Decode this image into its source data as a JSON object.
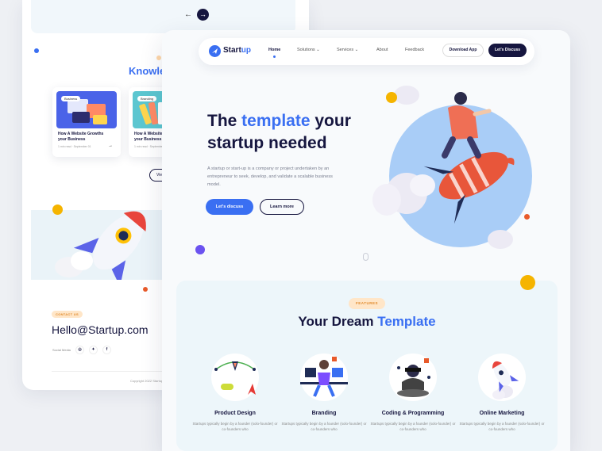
{
  "back_card": {
    "pager": {
      "prev_icon": "←",
      "next_icon": "→"
    },
    "section_title": "Knowle",
    "articles": [
      {
        "tag": "Business",
        "title": "How A Website Growths your Business",
        "meta": "1 min read · September 01",
        "arrow": "→"
      },
      {
        "tag": "Branding",
        "title": "How A Website Growths your Business",
        "meta": "1 min read · September 01",
        "arrow": ""
      }
    ],
    "view_label": "View",
    "contact_badge": "CONTACT US",
    "email": "Hello@Startup.com",
    "email_arrow": "→",
    "social_label": "Social Media",
    "social_icons": [
      "◎",
      "✦",
      "f"
    ],
    "copyright": "Copyright 2022 Startup"
  },
  "nav": {
    "logo_text": "Start",
    "logo_accent": "up",
    "items": [
      "Home",
      "Solutions ⌄",
      "Services ⌄",
      "About",
      "Feedback"
    ],
    "download_label": "Download App",
    "discuss_label": "Let's Discuss"
  },
  "hero": {
    "title_pre": "The ",
    "title_accent": "template",
    "title_post": " your startup needed",
    "description": "A startup or start-up is a company or project undertaken by an entrepreneur to seek, develop, and validate a scalable business model.",
    "primary_button": "Let's discuss",
    "secondary_button": "Learn more"
  },
  "features": {
    "badge": "FEATURES",
    "title_pre": "Your Dream ",
    "title_accent": "Template",
    "items": [
      {
        "name": "Product Design",
        "desc": "Startups typically begin by a founder (solo-founder) or co-founders who"
      },
      {
        "name": "Branding",
        "desc": "Startups typically begin by a founder (solo-founder) or co-founders who"
      },
      {
        "name": "Coding & Programming",
        "desc": "Startups typically begin by a founder (solo-founder) or co-founders who"
      },
      {
        "name": "Online Marketing",
        "desc": "Startups typically begin by a founder (solo-founder) or co-founders who"
      }
    ]
  },
  "colors": {
    "accent": "#3a6ff2",
    "navy": "#16163f",
    "orange": "#f5b400",
    "red": "#e85a2a",
    "purple": "#6b52f0"
  }
}
